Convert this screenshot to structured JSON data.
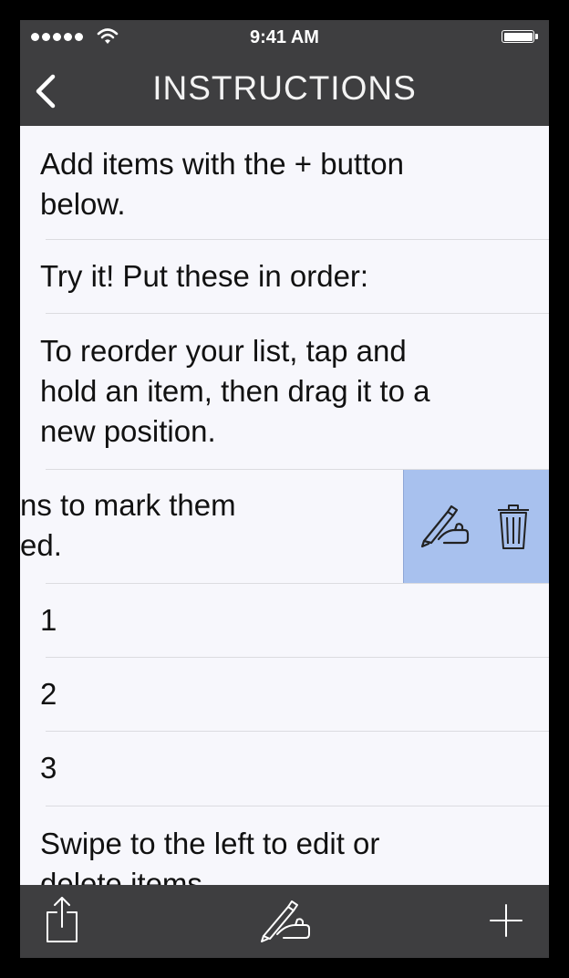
{
  "status_bar": {
    "time": "9:41 AM",
    "signal_icon": "signal-dots-icon",
    "wifi_icon": "wifi-icon",
    "battery_icon": "battery-icon"
  },
  "nav": {
    "title": "INSTRUCTIONS",
    "back_icon": "chevron-left-icon"
  },
  "list": {
    "items": [
      {
        "text": "Add items with the + button\nbelow."
      },
      {
        "text": "Try it! Put these in order:"
      },
      {
        "text": "To reorder your list, tap and\nhold an item, then drag it to a\nnew position."
      },
      {
        "text": "Tap items to mark them\ncompleted.",
        "visible_text": "ns to mark them\ned."
      },
      {
        "text": "1"
      },
      {
        "text": "2"
      },
      {
        "text": "3"
      },
      {
        "text": "Swipe to the left to edit or\ndelete items."
      }
    ],
    "swipe_actions": {
      "edit_icon": "writing-hand-icon",
      "delete_icon": "trash-icon",
      "background": "#a8c1ee"
    }
  },
  "toolbar": {
    "share_icon": "share-icon",
    "compose_icon": "writing-hand-icon",
    "add_icon": "plus-icon"
  },
  "colors": {
    "bar_background": "#3e3e40",
    "list_background": "#f7f7fc",
    "separator": "#dcdce0",
    "text": "#111111"
  }
}
